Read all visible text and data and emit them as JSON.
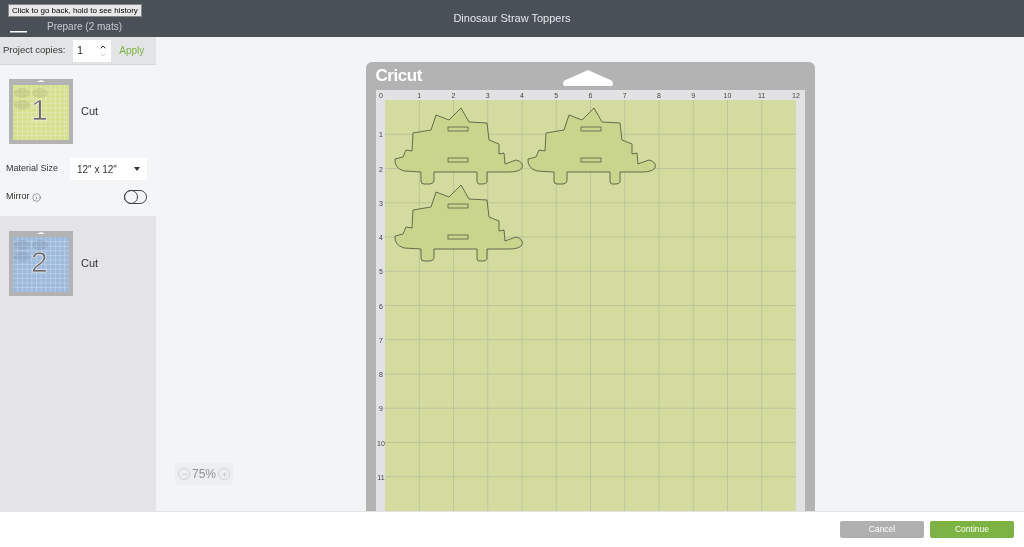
{
  "header": {
    "menu_tooltip": "Click to go back, hold to see history",
    "back_label": "Prepare (2 mats)",
    "title": "Dinosaur Straw Toppers"
  },
  "copies": {
    "label": "Project copies:",
    "value": "1",
    "apply": "Apply"
  },
  "mats": [
    {
      "number": "1",
      "label": "Cut",
      "selected": true,
      "color": "#d6e08f",
      "material_size": {
        "label": "Material Size",
        "value": "12\" x 12\""
      },
      "mirror": {
        "label": "Mirror",
        "on": false
      }
    },
    {
      "number": "2",
      "label": "Cut",
      "selected": false,
      "color": "#9db9dc"
    }
  ],
  "canvas": {
    "brand": "Cricut",
    "top_ruler": [
      "0",
      "1",
      "2",
      "3",
      "4",
      "5",
      "6",
      "7",
      "8",
      "9",
      "10",
      "11",
      "12"
    ],
    "left_ruler": [
      "1",
      "2",
      "3",
      "4",
      "5",
      "6",
      "7",
      "8",
      "9",
      "10",
      "11"
    ]
  },
  "zoom": {
    "value": "75%"
  },
  "buttons": [
    {
      "label": "Cancel",
      "kind": "secondary"
    },
    {
      "label": "Continue",
      "kind": "primary"
    }
  ]
}
